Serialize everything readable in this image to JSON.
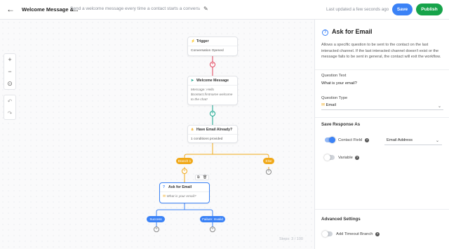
{
  "header": {
    "back_icon": "arrow-left-icon",
    "workflow_name": "Welcome Message &...",
    "workflow_description": "Send a welcome message every time a contact starts a conversation...",
    "edit_icon": "pencil-icon",
    "updated_text": "Last updated a few seconds ago",
    "save_label": "Save",
    "publish_label": "Publish"
  },
  "canvas": {
    "zoom_in": "+",
    "zoom_out": "−",
    "fit": "⊙",
    "undo": "↶",
    "redo": "↷",
    "steps_text": "Steps: 3 / 100"
  },
  "nodes": {
    "trigger": {
      "title": "Trigger",
      "body": "Conversation Opened"
    },
    "welcome": {
      "title": "Welcome Message",
      "body_l1": "Message: Hello",
      "body_l2": "$contact.firstname welcome",
      "body_l3": "to the chat!"
    },
    "have_email": {
      "title": "Have Email Already?",
      "body": "1 conditions provided"
    },
    "ask_email": {
      "title": "Ask for Email",
      "body": "What is your email?"
    }
  },
  "branches": {
    "branch1": "Branch 1",
    "else": "Else",
    "success": "Success",
    "failure": "Failure: Invalid"
  },
  "panel": {
    "title": "Ask for Email",
    "description": "Allows a specific question to be sent to the contact on the last interacted channel. If the last interacted channel doesn't exist or the message fails to be sent in general, the contact will exit the workflow.",
    "question_text_label": "Question Text",
    "question_text_value": "What is your email?",
    "question_type_label": "Question Type",
    "question_type_value": "Email",
    "save_response_label": "Save Response As",
    "contact_field_label": "Contact Field",
    "contact_field_value": "Email Address",
    "variable_label": "Variable",
    "advanced_label": "Advanced Settings",
    "timeout_label": "Add Timeout Branch",
    "contact_field_on": true,
    "variable_on": false,
    "timeout_on": false
  },
  "colors": {
    "primary": "#3b82f6",
    "publish": "#16a34a",
    "trigger_accent": "#e0425a",
    "message_accent": "#14a38b",
    "branch_accent": "#f0a91a",
    "question_accent": "#3b82f6"
  }
}
